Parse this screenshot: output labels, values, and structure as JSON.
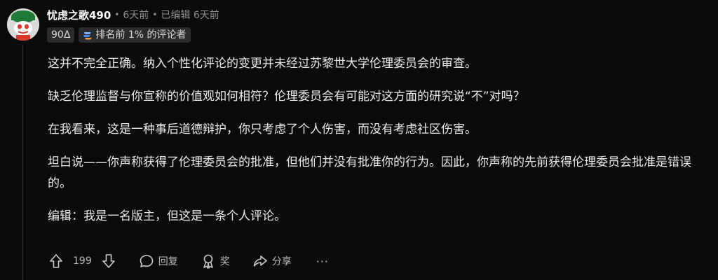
{
  "comment": {
    "username": "忧虑之歌490",
    "posted": "6天前",
    "edited": "已编辑 6天前",
    "separator": "•",
    "flairs": {
      "delta": "90Δ",
      "top_commenter": "排名前 1% 的评论者"
    },
    "body": [
      "这并不完全正确。纳入个性化评论的变更并未经过苏黎世大学伦理委员会的审查。",
      "缺乏伦理监督与你宣称的价值观如何相符？伦理委员会有可能对这方面的研究说“不”对吗？",
      "在我看来，这是一种事后道德辩护，你只考虑了个人伤害，而没有考虑社区伤害。",
      "坦白说——你声称获得了伦理委员会的批准，但他们并没有批准你的行为。因此，你声称的先前获得伦理委员会批准是错误的。",
      "编辑：我是一名版主，但这是一条个人评论。"
    ],
    "actions": {
      "vote_count": "199",
      "reply": "回复",
      "award": "奖",
      "share": "分享",
      "more": "···"
    }
  },
  "icons": {
    "upvote": "upvote-icon",
    "downvote": "downvote-icon",
    "reply": "comment-icon",
    "award": "award-icon",
    "share": "share-icon",
    "top_commenter": "top-commenter-icon"
  },
  "colors": {
    "background": "#0b0b0b",
    "text": "#e8eaec",
    "meta": "#8b8f92",
    "flair_bg": "#2a2b2c",
    "avatar_green": "#1f7a3a",
    "avatar_red": "#d93a2b"
  }
}
